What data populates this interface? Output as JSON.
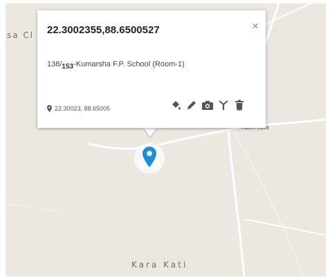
{
  "map": {
    "labels": {
      "top_left": "sa Cl",
      "road_village": "Roin Yola",
      "bottom": "Kara Kati"
    }
  },
  "popup": {
    "title": "22.3002355,88.6500527",
    "description": {
      "prefix": "138/",
      "subscript": "153",
      "suffix": "-Kumarsha F.P. School (Room-1)"
    },
    "coordinates": "22.30023, 88.65005",
    "close_label": "×",
    "actions": [
      {
        "name": "fill-color-icon"
      },
      {
        "name": "edit-pencil-icon"
      },
      {
        "name": "camera-icon"
      },
      {
        "name": "antenna-icon"
      },
      {
        "name": "delete-trash-icon"
      }
    ]
  },
  "colors": {
    "marker": "#1a8fd8",
    "map_background": "#ece8e0",
    "road": "#ffffff"
  }
}
